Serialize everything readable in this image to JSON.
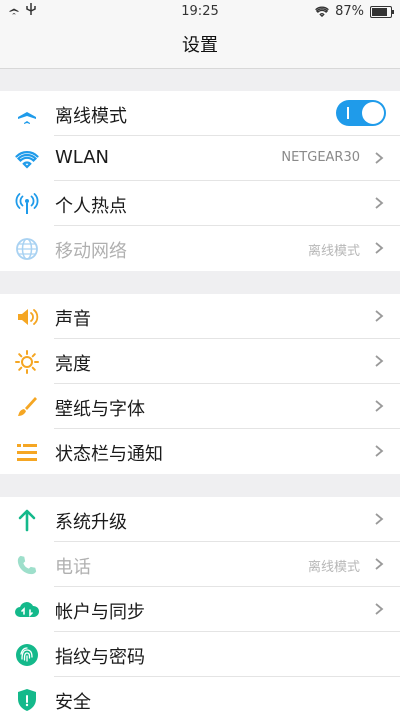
{
  "status_bar": {
    "time": "19:25",
    "battery": "87%"
  },
  "header": {
    "title": "设置"
  },
  "sections": [
    {
      "items": [
        {
          "label": "离线模式",
          "icon": "airplane-icon",
          "toggle": true
        },
        {
          "label": "WLAN",
          "icon": "wifi-icon",
          "value": "NETGEAR30"
        },
        {
          "label": "个人热点",
          "icon": "hotspot-icon"
        },
        {
          "label": "移动网络",
          "icon": "globe-icon",
          "value": "离线模式",
          "disabled": true
        }
      ]
    },
    {
      "items": [
        {
          "label": "声音",
          "icon": "speaker-icon"
        },
        {
          "label": "亮度",
          "icon": "sun-icon"
        },
        {
          "label": "壁纸与字体",
          "icon": "brush-icon"
        },
        {
          "label": "状态栏与通知",
          "icon": "list-icon"
        }
      ]
    },
    {
      "items": [
        {
          "label": "系统升级",
          "icon": "arrow-up-icon"
        },
        {
          "label": "电话",
          "icon": "phone-icon",
          "value": "离线模式",
          "disabled": true
        },
        {
          "label": "帐户与同步",
          "icon": "cloud-sync-icon"
        },
        {
          "label": "指纹与密码",
          "icon": "fingerprint-icon"
        },
        {
          "label": "安全",
          "icon": "shield-icon"
        }
      ]
    }
  ],
  "colors": {
    "accent_blue": "#1f9bea",
    "orange": "#f5a623",
    "green": "#14b98b"
  }
}
